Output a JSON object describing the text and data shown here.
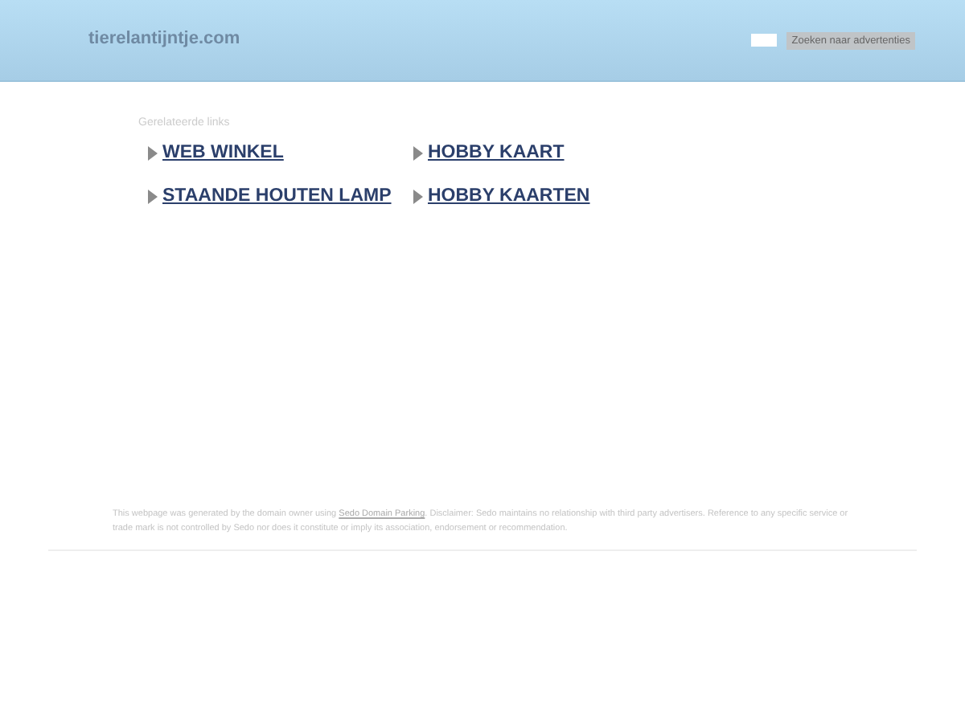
{
  "header": {
    "domain": "tierelantijntje.com",
    "search": {
      "button": "Zoeken naar advertenties"
    }
  },
  "related": {
    "title": "Gerelateerde links",
    "links": [
      {
        "label": "WEB WINKEL"
      },
      {
        "label": "HOBBY KAART"
      },
      {
        "label": "STAANDE HOUTEN LAMP"
      },
      {
        "label": "HOBBY KAARTEN"
      }
    ]
  },
  "footer": {
    "before": "This webpage was generated by the domain owner using ",
    "link": "Sedo Domain Parking",
    "after": ". Disclaimer: Sedo maintains no relationship with third party advertisers. Reference to any specific service or trade mark is not controlled by Sedo nor does it constitute or imply its association, endorsement or recommendation."
  }
}
